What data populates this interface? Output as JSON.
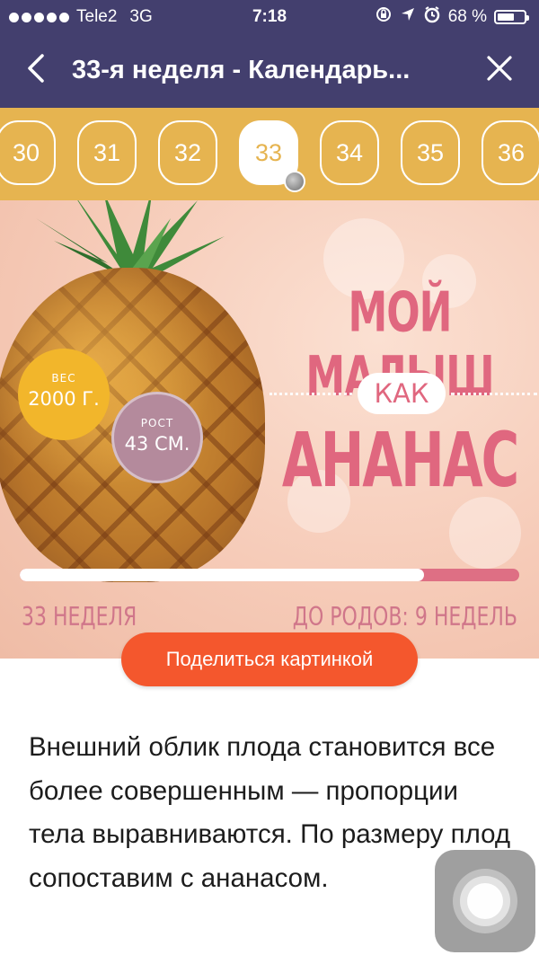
{
  "status_bar": {
    "carrier": "Tele2",
    "network": "3G",
    "time": "7:18",
    "battery": "68 %",
    "battery_level": 0.68,
    "icons": [
      "lock-rotation-icon",
      "location-arrow-icon",
      "alarm-icon",
      "battery-icon"
    ]
  },
  "nav": {
    "title": "33-я неделя - Календарь...",
    "back_icon": "chevron-left-icon",
    "close_icon": "close-icon"
  },
  "weeks": {
    "items": [
      "30",
      "31",
      "32",
      "33",
      "34",
      "35",
      "36"
    ],
    "selected": "33"
  },
  "banner": {
    "headline_top": "МОЙ МАЛЫШ",
    "headline_mid": "КАК",
    "headline_bottom": "АНАНАС",
    "weight_label": "ВЕС",
    "weight_value": "2000 Г.",
    "height_label": "РОСТ",
    "height_value": "43 СМ.",
    "progress_fraction": 0.81,
    "week_label": "33 НЕДЕЛЯ",
    "weeks_left_label": "ДО РОДОВ: 9 НЕДЕЛЬ"
  },
  "share_button": "Поделиться картинкой",
  "article": {
    "text": "Внешний облик плода становится все более совершенным — пропорции тела выравниваются. По размеру плод сопоставим с ананасом."
  },
  "colors": {
    "nav_bg": "#433f6e",
    "strip_bg": "#e6b450",
    "accent_pink": "#e0677f",
    "share_orange": "#f4572d",
    "weight_badge": "#f2b62b",
    "height_badge": "#b48a9c"
  }
}
